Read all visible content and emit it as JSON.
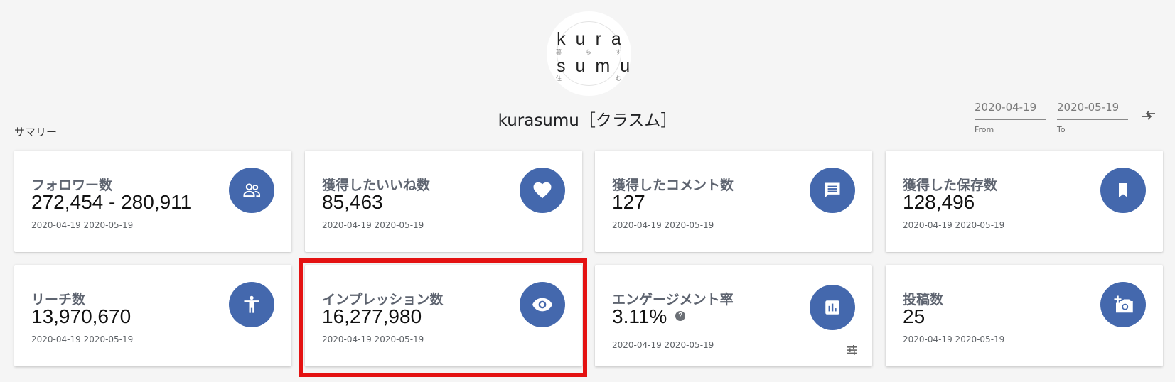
{
  "account": {
    "logo_top": "kura",
    "logo_bottom": "sumu",
    "logo_small_top": [
      "暮",
      "ら",
      "す"
    ],
    "logo_small_bottom": [
      "住",
      "む"
    ],
    "name": "kurasumu［クラスム］"
  },
  "summary_label": "サマリー",
  "date_range": {
    "from_value": "2020-04-19",
    "from_label": "From",
    "to_value": "2020-05-19",
    "to_label": "To",
    "swap_icon": "swap-icon"
  },
  "colors": {
    "accent": "#4468ad",
    "highlight": "#e41212",
    "background": "#f5f5f5"
  },
  "cards": [
    {
      "title": "フォロワー数",
      "value": "272,454 - 280,911",
      "date": "2020-04-19 2020-05-19",
      "icon": "people-icon"
    },
    {
      "title": "獲得したいいね数",
      "value": "85,463",
      "date": "2020-04-19 2020-05-19",
      "icon": "heart-icon"
    },
    {
      "title": "獲得したコメント数",
      "value": "127",
      "date": "2020-04-19 2020-05-19",
      "icon": "comment-icon"
    },
    {
      "title": "獲得した保存数",
      "value": "128,496",
      "date": "2020-04-19 2020-05-19",
      "icon": "bookmark-icon"
    },
    {
      "title": "リーチ数",
      "value": "13,970,670",
      "date": "2020-04-19 2020-05-19",
      "icon": "person-icon"
    },
    {
      "title": "インプレッション数",
      "value": "16,277,980",
      "date": "2020-04-19 2020-05-19",
      "icon": "eye-icon"
    },
    {
      "title": "エンゲージメント率",
      "value": "3.11%",
      "date": "2020-04-19 2020-05-19",
      "icon": "bar-chart-icon",
      "help": "?"
    },
    {
      "title": "投稿数",
      "value": "25",
      "date": "2020-04-19 2020-05-19",
      "icon": "add-photo-icon"
    }
  ]
}
